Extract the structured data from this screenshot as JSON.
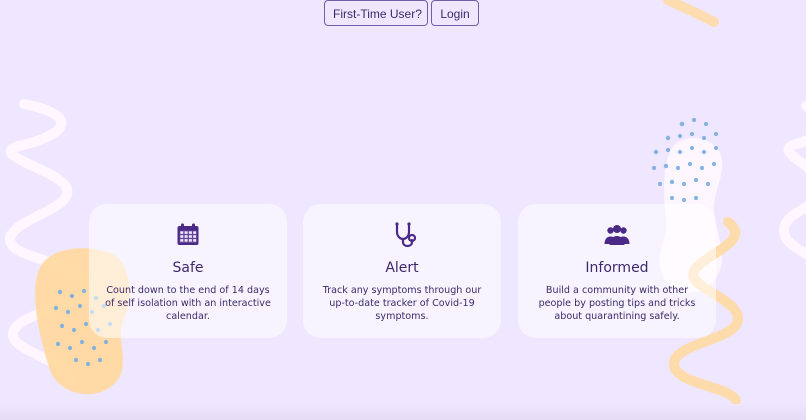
{
  "header": {
    "first_time_label": "First-Time User?",
    "login_label": "Login"
  },
  "features": [
    {
      "title": "Safe",
      "icon": "calendar-icon",
      "text": "Count down to the end of 14 days of self isolation with an interactive calendar."
    },
    {
      "title": "Alert",
      "icon": "stethoscope-icon",
      "text": "Track any symptoms through our up-to-date tracker of Covid-19 symptoms."
    },
    {
      "title": "Informed",
      "icon": "users-icon",
      "text": "Build a community with other people by posting tips and tricks about quarantining safely."
    }
  ],
  "colors": {
    "background": "#efe6ff",
    "primary": "#4b2a87",
    "text": "#3b2a6a",
    "accent_peach": "#ffd9a1",
    "accent_blue": "#7fb0e0"
  }
}
